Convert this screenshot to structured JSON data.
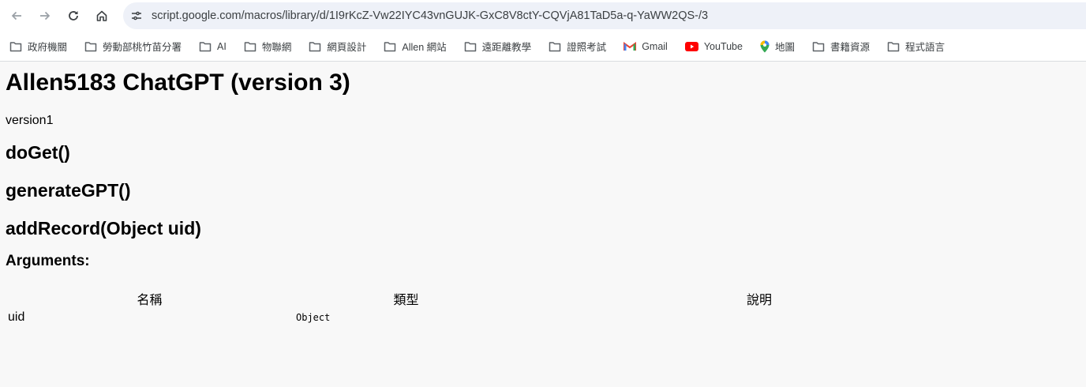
{
  "browser": {
    "url": "script.google.com/macros/library/d/1I9rKcZ-Vw22IYC43vnGUJK-GxC8V8ctY-CQVjA81TaD5a-q-YaWW2QS-/3",
    "bookmarks": [
      {
        "label": "政府機關",
        "icon": "folder-icon"
      },
      {
        "label": "勞動部桃竹苗分署",
        "icon": "folder-icon"
      },
      {
        "label": "AI",
        "icon": "folder-icon"
      },
      {
        "label": "物聯網",
        "icon": "folder-icon"
      },
      {
        "label": "網頁設計",
        "icon": "folder-icon"
      },
      {
        "label": "Allen 網站",
        "icon": "folder-icon"
      },
      {
        "label": "遠距離教學",
        "icon": "folder-icon"
      },
      {
        "label": "證照考試",
        "icon": "folder-icon"
      },
      {
        "label": "Gmail",
        "icon": "gmail-icon"
      },
      {
        "label": "YouTube",
        "icon": "youtube-icon"
      },
      {
        "label": "地圖",
        "icon": "maps-pin-icon"
      },
      {
        "label": "書籍資源",
        "icon": "folder-icon"
      },
      {
        "label": "程式語言",
        "icon": "folder-icon"
      }
    ]
  },
  "page": {
    "title": "Allen5183 ChatGPT (version 3)",
    "description": "version1",
    "functions": [
      "doGet()",
      "generateGPT()",
      "addRecord(Object uid)"
    ],
    "arguments_heading": "Arguments:",
    "table": {
      "headers": [
        "名稱",
        "類型",
        "說明"
      ],
      "rows": [
        {
          "name": "uid",
          "type": "Object",
          "description": ""
        }
      ]
    }
  },
  "colors": {
    "page_bg": "#f8f8f8",
    "omnibox_bg": "#eef1f8",
    "icon_gray": "#5f6368"
  }
}
